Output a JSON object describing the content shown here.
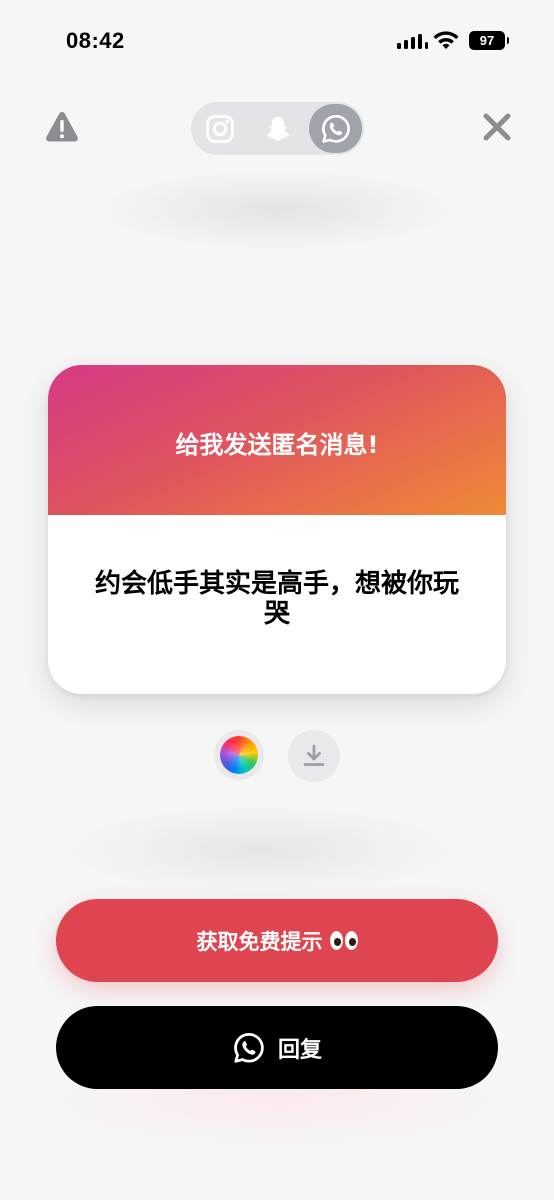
{
  "status_bar": {
    "time": "08:42",
    "battery": "97"
  },
  "header": {
    "warning_icon": "warning-triangle-icon",
    "close_icon": "close-x-icon",
    "platforms": [
      {
        "icon": "instagram-icon",
        "selected": false
      },
      {
        "icon": "snapchat-icon",
        "selected": false
      },
      {
        "icon": "whatsapp-icon",
        "selected": true
      }
    ]
  },
  "card": {
    "title": "给我发送匿名消息!",
    "message": "约会低手其实是高手，想被你玩哭",
    "gradient_colors": [
      "#d53a86",
      "#e0545e",
      "#ee8a36"
    ]
  },
  "tools": {
    "color_picker_icon": "color-wheel-icon",
    "download_icon": "download-icon"
  },
  "buttons": {
    "hint_label": "获取免费提示",
    "hint_emoji": "eyes-emoji",
    "reply_label": "回复",
    "reply_icon": "whatsapp-icon"
  },
  "colors": {
    "hint_button": "#df4550",
    "reply_button": "#000000",
    "background": "#f6f6f7"
  }
}
